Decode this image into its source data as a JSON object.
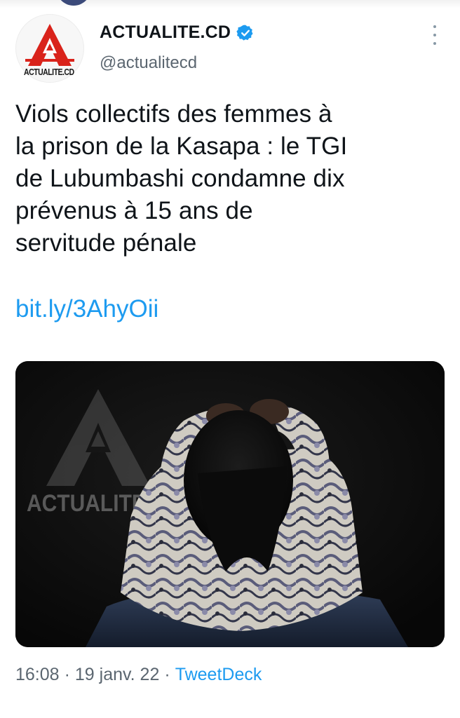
{
  "account": {
    "display_name": "ACTUALITE.CD",
    "handle": "@actualitecd",
    "avatar_logo_text": "ACTUALITE.CD",
    "verified": true
  },
  "tweet": {
    "text_lines": [
      "Viols collectifs des femmes à",
      "la prison de la Kasapa : le TGI",
      "de Lubumbashi condamne dix",
      "prévenus à 15 ans de",
      "servitude pénale"
    ],
    "link": "bit.ly/3AhyOii"
  },
  "media": {
    "watermark_text": "ACTUALITE"
  },
  "meta": {
    "time": "16:08",
    "separator": "·",
    "date": "19 janv. 22",
    "source": "TweetDeck"
  },
  "icons": {
    "verified": "verified-badge-icon",
    "more": "more-vertical-icon"
  },
  "colors": {
    "link": "#1d9bf0",
    "brand_red": "#d9231b",
    "text": "#0f1419",
    "muted": "#5b6670"
  }
}
